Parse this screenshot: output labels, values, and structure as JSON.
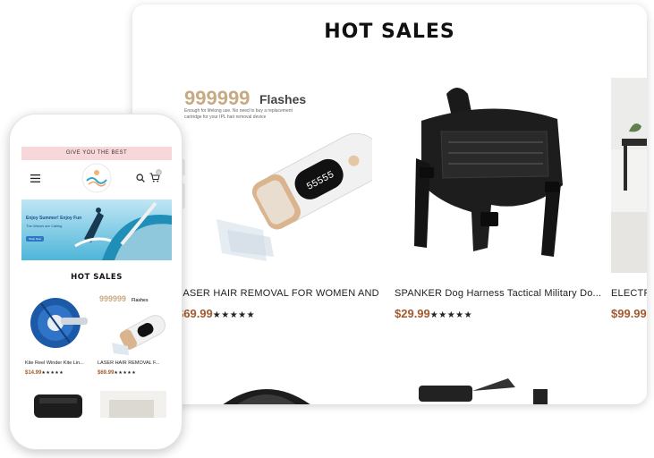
{
  "desktop": {
    "title": "HOT SALES",
    "products": [
      {
        "name": "LASER HAIR REMOVAL FOR WOMEN AND ...",
        "price": "$69.99",
        "rating": "★★★★★",
        "image_text": {
          "headline": "999999",
          "headline_suffix": "Flashes",
          "caption": "Enough for lifelong use. No need to buy a replacement cartridge for your IPL hair removal device"
        }
      },
      {
        "name": "SPANKER Dog Harness Tactical Military Do...",
        "price": "$29.99",
        "rating": "★★★★★"
      },
      {
        "name": "ELECTRI",
        "price": "$99.99",
        "rating": ""
      }
    ]
  },
  "phone": {
    "banner": "GIVE YOU THE BEST",
    "hero": {
      "line1": "Enjoy Summer! Enjoy Fun",
      "line2": "The Waves are Calling",
      "button": "Shop Now"
    },
    "title": "HOT SALES",
    "products": [
      {
        "name": "Kite Reel Winder Kite Lin...",
        "price": "$14.99",
        "rating": "★★★★★"
      },
      {
        "name": "LASER HAIR REMOVAL F...",
        "price": "$69.99",
        "rating": "★★★★★"
      }
    ],
    "cart_count": "0"
  }
}
